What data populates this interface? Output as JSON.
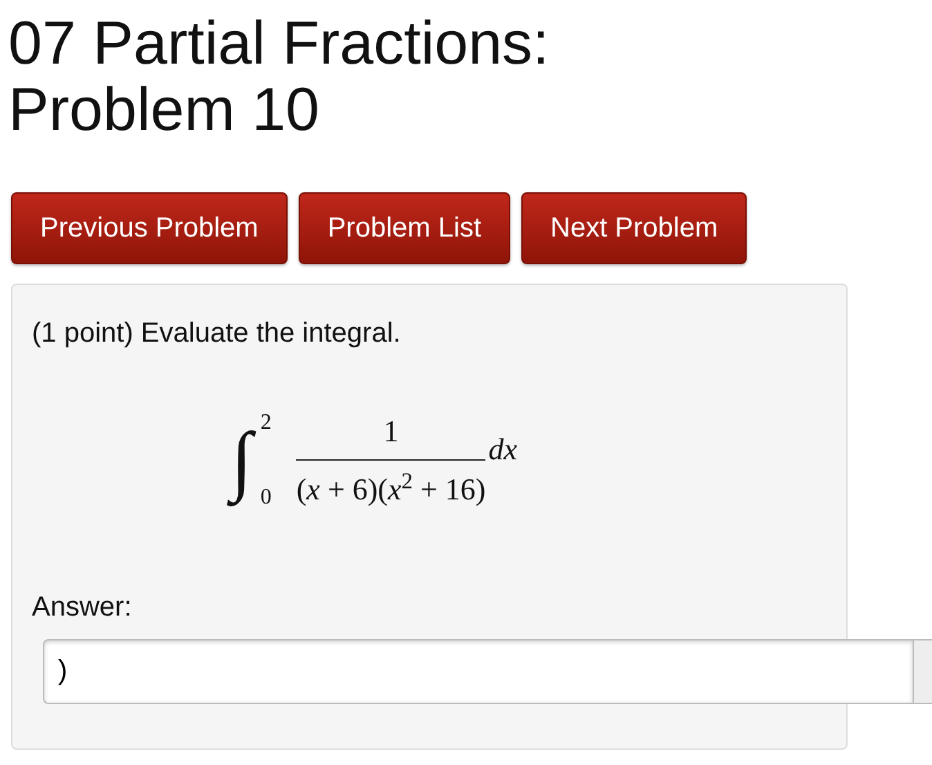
{
  "title": "07 Partial Fractions: Problem 10",
  "buttons": [
    "Previous Problem",
    "Problem List",
    "Next Problem"
  ],
  "problem": {
    "statement": "(1 point) Evaluate the integral.",
    "math": {
      "integral_sign": "∫",
      "upper": "2",
      "lower": "0",
      "numerator": "1",
      "denominator": "(*x* + 6)(*x*$^{2}$ + 16)",
      "differential": "dx"
    },
    "answer_label": "Answer:",
    "answer_value": ")"
  }
}
